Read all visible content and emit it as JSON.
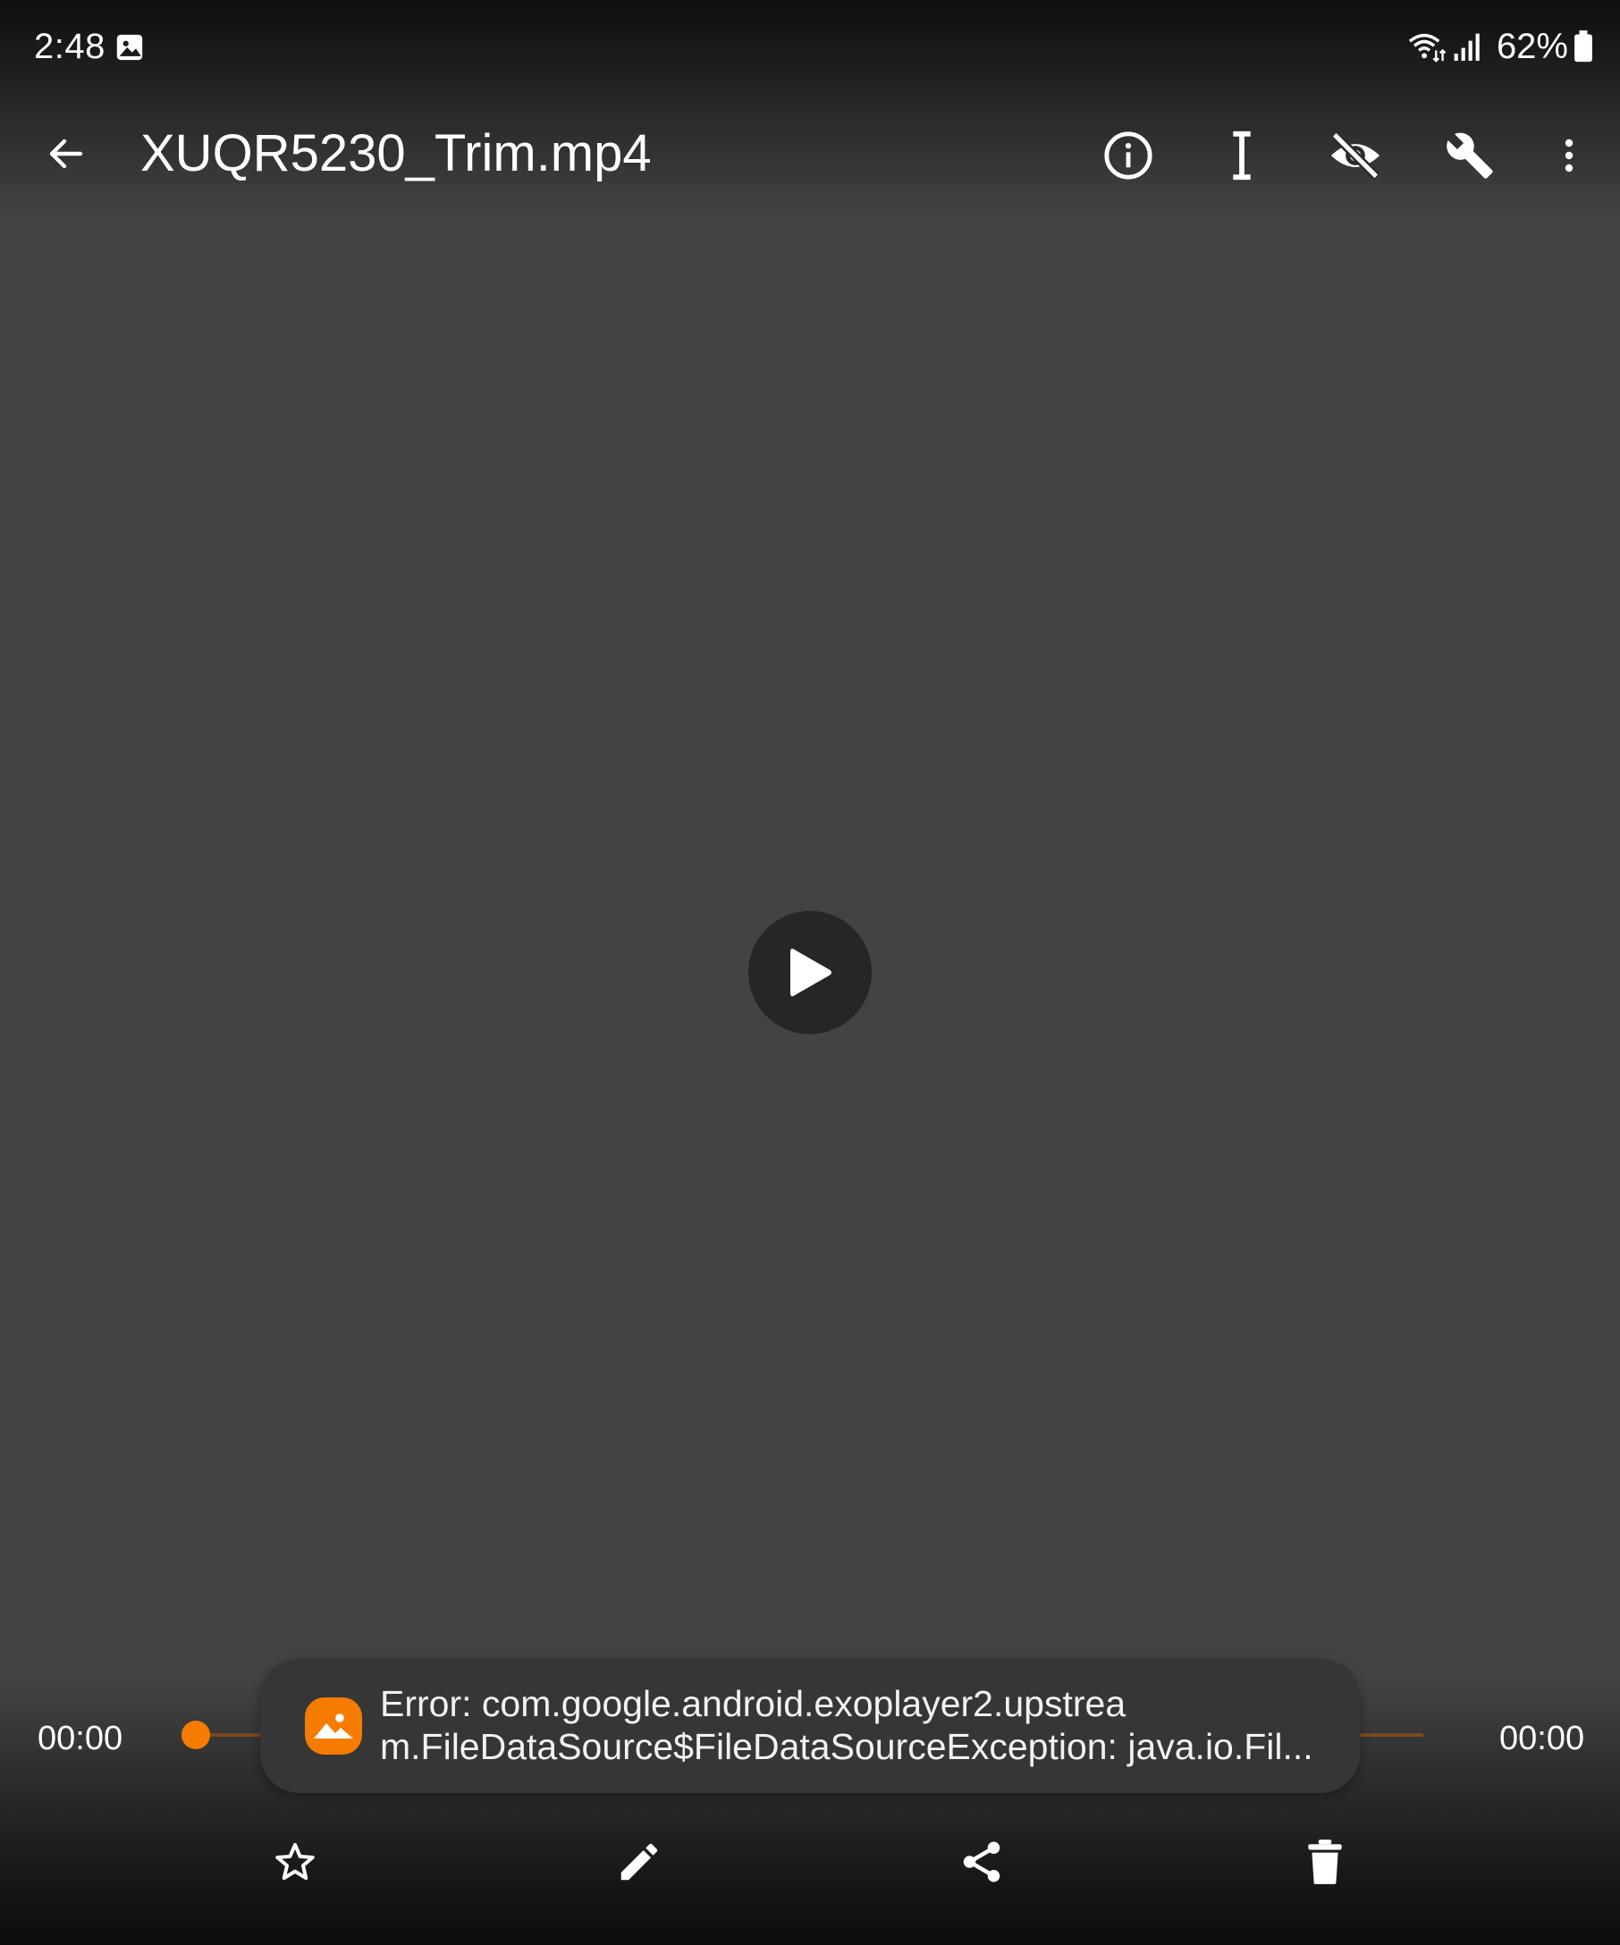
{
  "status_bar": {
    "time": "2:48",
    "battery_percent": "62%",
    "icons": [
      "image-notification-icon",
      "wifi-icon",
      "signal-icon",
      "battery-icon"
    ]
  },
  "app_bar": {
    "title": "XUQR5230_Trim.mp4",
    "actions": [
      "info-icon",
      "text-cursor-icon",
      "visibility-off-icon",
      "wrench-icon",
      "more-vert-icon"
    ]
  },
  "player": {
    "current_time": "00:00",
    "total_time": "00:00",
    "progress": 0
  },
  "toast": {
    "message": "Error: com.google.android.exoplayer2.upstrea\nm.FileDataSource$FileDataSourceException: java.io.Fil..."
  },
  "bottom_actions": [
    "star-outline-icon",
    "pencil-icon",
    "share-icon",
    "trash-icon"
  ],
  "colors": {
    "accent": "#f57c00",
    "background": "#434343",
    "toast_bg": "#363636"
  }
}
